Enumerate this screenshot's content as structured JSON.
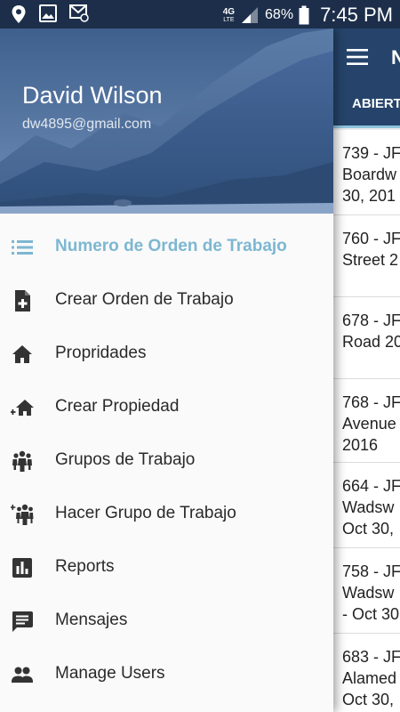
{
  "status_bar": {
    "network": "4G",
    "network_sub": "LTE",
    "battery": "68%",
    "time": "7:45 PM"
  },
  "drawer": {
    "user_name": "David Wilson",
    "user_email": "dw4895@gmail.com",
    "items": [
      {
        "label": "Numero de Orden de Trabajo",
        "icon": "list-icon",
        "active": true
      },
      {
        "label": "Crear Orden de Trabajo",
        "icon": "add-document-icon"
      },
      {
        "label": "Propridades",
        "icon": "home-icon"
      },
      {
        "label": "Crear Propiedad",
        "icon": "add-home-icon"
      },
      {
        "label": "Grupos de Trabajo",
        "icon": "group-icon"
      },
      {
        "label": "Hacer Grupo de Trabajo",
        "icon": "add-group-icon"
      },
      {
        "label": "Reports",
        "icon": "chart-icon"
      },
      {
        "label": "Mensajes",
        "icon": "message-icon"
      },
      {
        "label": "Manage Users",
        "icon": "users-icon"
      }
    ]
  },
  "background": {
    "title_partial": "N",
    "tab_partial": "ABIERT",
    "items": [
      {
        "lines": [
          "739 - JF",
          "Boardw",
          "30, 201"
        ]
      },
      {
        "lines": [
          "760 - JF",
          "Street 2"
        ]
      },
      {
        "lines": [
          "678 - JF",
          "Road 20"
        ]
      },
      {
        "lines": [
          "768 - JF",
          "Avenue",
          "2016"
        ]
      },
      {
        "lines": [
          "664 - JF",
          "Wadsw",
          "Oct 30,"
        ]
      },
      {
        "lines": [
          "758 - JF",
          "Wadsw",
          "- Oct 30"
        ]
      },
      {
        "lines": [
          "683 - JF",
          "Alamed",
          "Oct 30,"
        ]
      }
    ]
  },
  "colors": {
    "toolbar": "#26446b",
    "accent": "#7db7d2",
    "status_bar": "#1c2e4a"
  }
}
